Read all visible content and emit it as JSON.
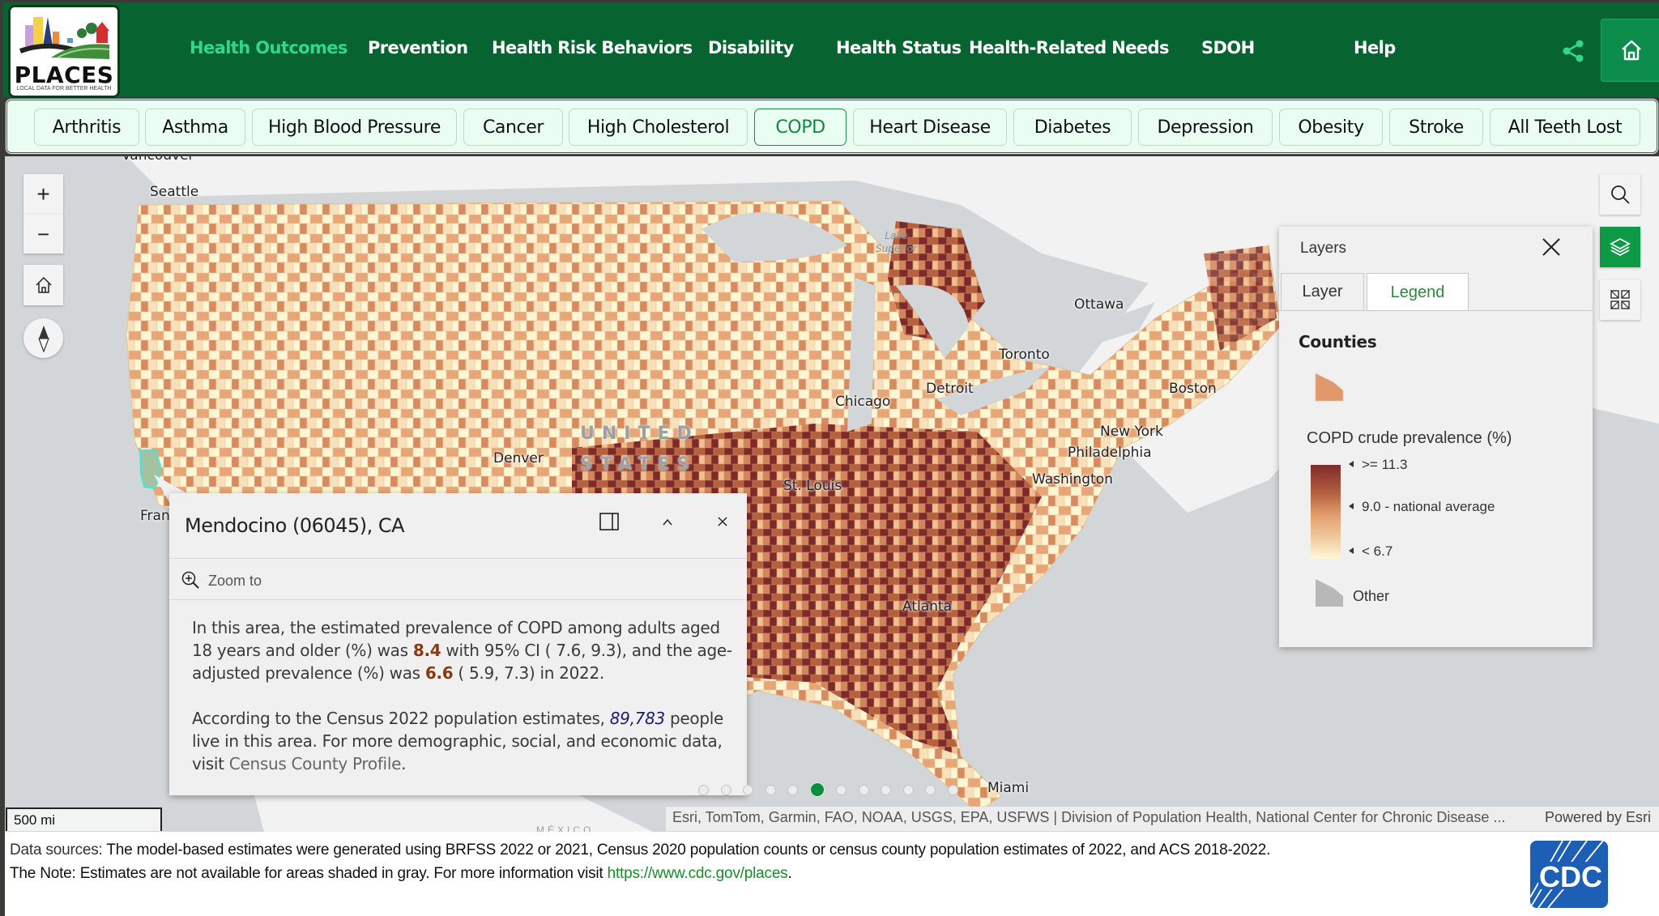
{
  "header": {
    "logo": {
      "title": "PLACES",
      "subtitle": "LOCAL DATA FOR BETTER HEALTH"
    },
    "nav": [
      {
        "label": "Health Outcomes",
        "active": true
      },
      {
        "label": "Prevention"
      },
      {
        "label": "Health Risk Behaviors"
      },
      {
        "label": "Disability"
      },
      {
        "label": "Health Status"
      },
      {
        "label": "Health-Related Needs"
      },
      {
        "label": "SDOH"
      },
      {
        "label": "Help"
      }
    ],
    "share_icon": "share-icon",
    "home_icon": "home-icon",
    "accent_color": "#2fd88a",
    "bar_color": "#076330"
  },
  "tabs": [
    {
      "label": "Arthritis"
    },
    {
      "label": "Asthma"
    },
    {
      "label": "High Blood Pressure"
    },
    {
      "label": "Cancer"
    },
    {
      "label": "High Cholesterol"
    },
    {
      "label": "COPD",
      "active": true
    },
    {
      "label": "Heart Disease"
    },
    {
      "label": "Diabetes"
    },
    {
      "label": "Depression"
    },
    {
      "label": "Obesity"
    },
    {
      "label": "Stroke"
    },
    {
      "label": "All Teeth Lost"
    }
  ],
  "map": {
    "controls": {
      "zoom_in": "+",
      "zoom_out": "−",
      "home_icon": "home-icon",
      "compass_icon": "compass-icon",
      "search_icon": "search-icon",
      "layers_icon": "layers-icon",
      "basemap_icon": "basemap-gallery-icon"
    },
    "cities": [
      "Vancouver",
      "Seattle",
      "Ottawa",
      "Toronto",
      "Chicago",
      "Detroit",
      "Boston",
      "New York",
      "Philadelphia",
      "Washington",
      "Denver",
      "St. Louis",
      "Atlanta",
      "Miami",
      "Fran"
    ],
    "country_label_1": "UNITED",
    "country_label_2": "STATES",
    "lake_label_1": "Lake",
    "lake_label_2": "Superior",
    "mexico_label": "MÉXICO",
    "scale": "500 mi",
    "attribution": "Esri, TomTom, Garmin, FAO, NOAA, USGS, EPA, USFWS | Division of Population Health, National Center for Chronic Disease ...",
    "powered_by": "Powered by Esri"
  },
  "popup": {
    "title": "Mendocino (06045), CA",
    "dock_icon": "dock-icon",
    "collapse_icon": "chevron-up-icon",
    "close_icon": "close-icon",
    "zoom_to": "Zoom to",
    "para1_a": "In this area, the estimated prevalence of COPD among adults aged 18 years and older (%) was ",
    "crude_value": "8.4",
    "para1_b": " with 95% CI ( 7.6, 9.3), and the age-adjusted prevalence (%) was ",
    "age_adjusted_value": "6.6",
    "para1_c": " ( 5.9, 7.3) in 2022.",
    "para2_a": "According to the Census 2022 population estimates, ",
    "population": "89,783",
    "para2_b": " people live in this area. For more demographic, social, and economic data, visit ",
    "census_link": "Census County Profile",
    "para2_c": ".",
    "pager": {
      "count": 12,
      "active_index": 5
    }
  },
  "layers_panel": {
    "title": "Layers",
    "tabs": [
      {
        "label": "Layer"
      },
      {
        "label": "Legend",
        "active": true
      }
    ],
    "legend": {
      "heading": "Counties",
      "field": "COPD crude prevalence (%)",
      "ramp_labels": [
        ">= 11.3",
        "9.0 - national average",
        "< 6.7"
      ],
      "ramp_colors": [
        "#7e2a2a",
        "#e09a6a",
        "#fdf8d8"
      ],
      "symbol_color": "#e0976a",
      "other_label": "Other",
      "other_color": "#b8b8b8"
    }
  },
  "footer": {
    "data_sources_label": "Data sources:",
    "data_sources_text": " The model-based estimates were generated using BRFSS 2022 or 2021, Census 2020 population counts or census county population estimates of 2022, and ACS 2018-2022.",
    "note_text": "The Note: Estimates are not available for areas shaded in gray. For more information visit ",
    "note_link": "https://www.cdc.gov/places",
    "note_end": ".",
    "cdc_logo_text": "CDC"
  }
}
